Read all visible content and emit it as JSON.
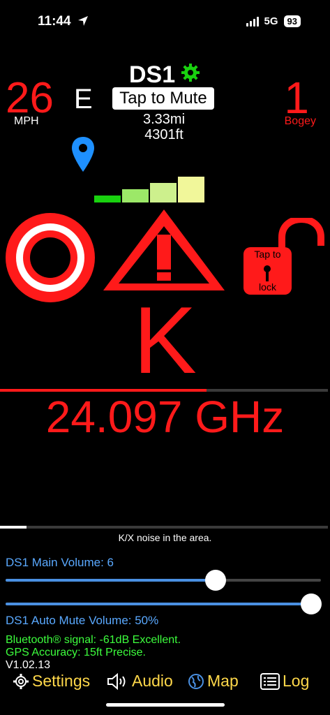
{
  "status_bar": {
    "time": "11:44",
    "network": "5G",
    "battery": "93"
  },
  "speed": {
    "value": "26",
    "unit": "MPH"
  },
  "heading": "E",
  "device": {
    "name": "DS1",
    "mute_label": "Tap to Mute",
    "distance": "3.33mi",
    "altitude": "4301ft"
  },
  "bogey": {
    "count": "1",
    "label": "Bogey"
  },
  "signal_strength": {
    "level": 4,
    "max": 4,
    "colors": [
      "#19d10f",
      "#9ce868",
      "#cdf08d",
      "#f1f79a"
    ]
  },
  "lock": {
    "label_top": "Tap to",
    "label_bottom": "lock"
  },
  "alert": {
    "band": "K",
    "frequency": "24.097 GHz",
    "band_progress": 0.63
  },
  "noise": {
    "message": "K/X noise in the area.",
    "progress": 0.08
  },
  "main_volume": {
    "label": "DS1 Main Volume: 6",
    "value": 6,
    "max": 9
  },
  "auto_mute": {
    "label": "DS1 Auto Mute Volume: 50%",
    "value": 1.0
  },
  "diagnostics": {
    "bluetooth": "Bluetooth® signal: -61dB Excellent.",
    "gps": "GPS Accuracy: 15ft Precise.",
    "version": "V1.02.13"
  },
  "tabs": {
    "settings": "Settings",
    "audio": "Audio",
    "map": "Map",
    "log": "Log"
  },
  "colors": {
    "alert_red": "#ff1a1a",
    "accent_blue": "#5aa9ff",
    "tab_yellow": "#ffd84a",
    "diag_green": "#3dff3d"
  }
}
